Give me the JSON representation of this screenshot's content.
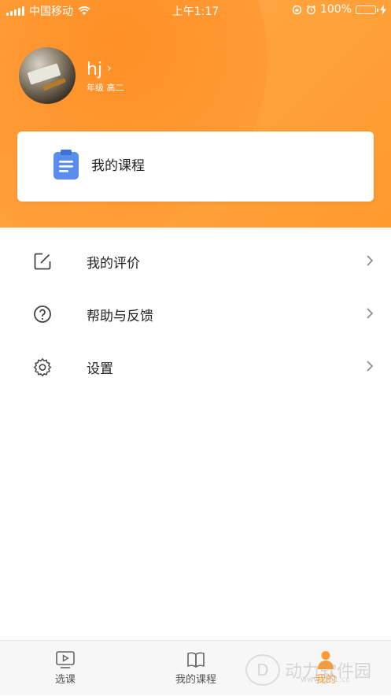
{
  "status_bar": {
    "carrier": "中国移动",
    "time": "上午1:17",
    "battery_percent": "100%"
  },
  "profile": {
    "username": "hj",
    "grade": "年级 高二"
  },
  "course_card": {
    "label": "我的课程",
    "icon": "document-icon"
  },
  "menu": {
    "items": [
      {
        "label": "我的评价",
        "icon": "edit-icon"
      },
      {
        "label": "帮助与反馈",
        "icon": "help-icon"
      },
      {
        "label": "设置",
        "icon": "gear-icon"
      }
    ]
  },
  "tabbar": {
    "tabs": [
      {
        "label": "选课",
        "icon": "play-video-icon",
        "active": false
      },
      {
        "label": "我的课程",
        "icon": "book-icon",
        "active": false
      },
      {
        "label": "我的",
        "icon": "person-icon",
        "active": true
      }
    ]
  },
  "watermark": {
    "text": "动力软件园",
    "sub": "www.jb51.cc"
  },
  "colors": {
    "accent": "#ff9a2e",
    "header_gradient_start": "#ffb057",
    "header_gradient_end": "#ff9a2e",
    "card_icon": "#5b8def",
    "battery": "#4cd964"
  }
}
